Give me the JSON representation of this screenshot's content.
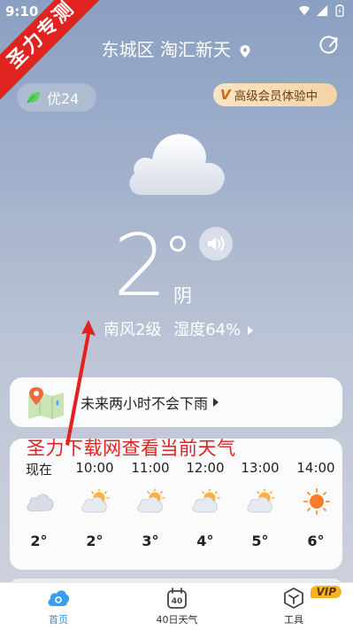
{
  "status_bar": {
    "time": "9:10"
  },
  "watermark": {
    "ribbon": "圣力专测",
    "caption": "圣力下载网查看当前天气"
  },
  "header": {
    "location": "东城区 淘汇新天"
  },
  "aqi": {
    "label": "优24"
  },
  "vip_promo": {
    "badge": "V",
    "label": "高级会员体验中"
  },
  "current": {
    "temperature": "2",
    "condition": "阴",
    "wind": "南风2级",
    "humidity": "湿度64%"
  },
  "rain_forecast": {
    "text": "未来两小时不会下雨"
  },
  "hourly": [
    {
      "time": "现在",
      "icon": "cloudy-icon",
      "temp": "2°"
    },
    {
      "time": "10:00",
      "icon": "partly-cloudy-icon",
      "temp": "2°"
    },
    {
      "time": "11:00",
      "icon": "partly-cloudy-icon",
      "temp": "3°"
    },
    {
      "time": "12:00",
      "icon": "partly-cloudy-icon",
      "temp": "4°"
    },
    {
      "time": "13:00",
      "icon": "partly-cloudy-icon",
      "temp": "5°"
    },
    {
      "time": "14:00",
      "icon": "sunny-icon",
      "temp": "6°"
    }
  ],
  "tabbar": {
    "tabs": [
      {
        "label": "首页",
        "icon": "cloud-home-icon",
        "active": true
      },
      {
        "label": "40日天气",
        "icon": "calendar-40-icon",
        "active": false
      },
      {
        "label": "工具",
        "icon": "cube-tool-icon",
        "active": false
      }
    ],
    "vip_tag": "VIP"
  },
  "colors": {
    "accent": "#2a8fe8",
    "watermark_red": "#e0231f",
    "vip_gold": "#f5b523"
  }
}
